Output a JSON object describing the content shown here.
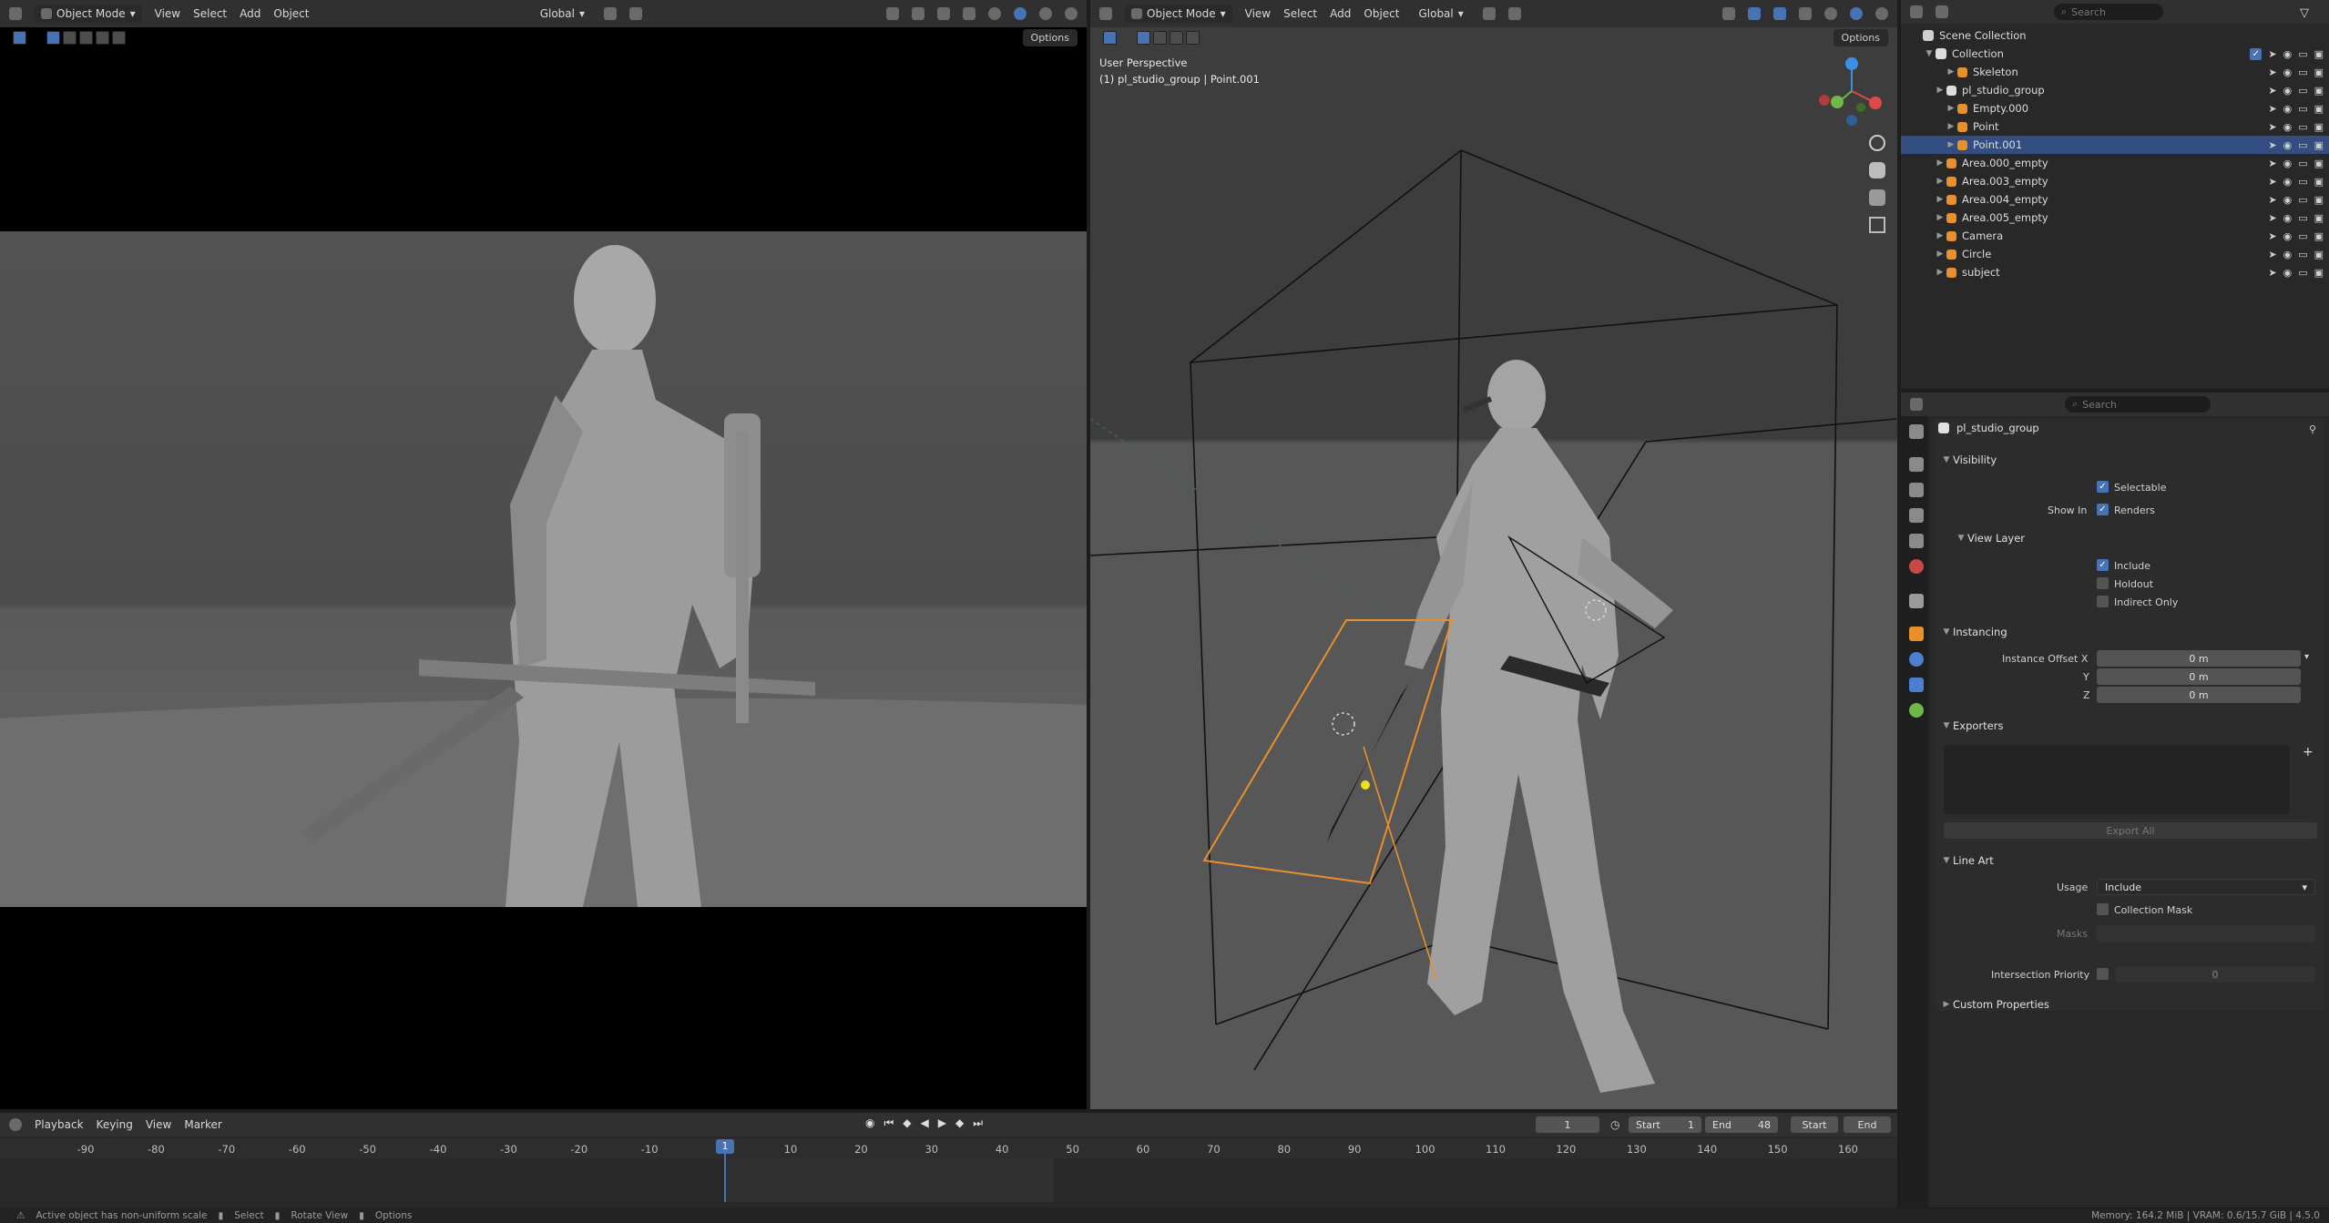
{
  "left_viewport": {
    "mode": "Object Mode",
    "menu": [
      "View",
      "Select",
      "Add",
      "Object"
    ],
    "orientation": "Global",
    "options": "Options"
  },
  "right_viewport": {
    "mode": "Object Mode",
    "menu": [
      "View",
      "Select",
      "Add",
      "Object"
    ],
    "orientation": "Global",
    "options": "Options",
    "overlay_title": "User Perspective",
    "overlay_sub": "(1) pl_studio_group | Point.001"
  },
  "outliner": {
    "search_placeholder": "Search",
    "scene_collection": "Scene Collection",
    "collection": "Collection",
    "rows": [
      {
        "label": "Skeleton",
        "indent": 2
      },
      {
        "label": "pl_studio_group",
        "indent": 1
      },
      {
        "label": "Empty.000",
        "indent": 2
      },
      {
        "label": "Point",
        "indent": 2
      },
      {
        "label": "Point.001",
        "indent": 2,
        "selected": true
      },
      {
        "label": "Area.000_empty",
        "indent": 1
      },
      {
        "label": "Area.003_empty",
        "indent": 1
      },
      {
        "label": "Area.004_empty",
        "indent": 1
      },
      {
        "label": "Area.005_empty",
        "indent": 1
      },
      {
        "label": "Camera",
        "indent": 1
      },
      {
        "label": "Circle",
        "indent": 1
      },
      {
        "label": "subject",
        "indent": 1
      }
    ]
  },
  "properties": {
    "search_placeholder": "Search",
    "object_name": "pl_studio_group",
    "visibility": "Visibility",
    "selectable": "Selectable",
    "show_in": "Show In",
    "renders": "Renders",
    "view_layer": "View Layer",
    "include": "Include",
    "holdout": "Holdout",
    "indirect_only": "Indirect Only",
    "instancing": "Instancing",
    "instance_offset_x": "Instance Offset X",
    "y": "Y",
    "z": "Z",
    "offset_x_val": "0 m",
    "offset_y_val": "0 m",
    "offset_z_val": "0 m",
    "exporters": "Exporters",
    "export_all": "Export All",
    "line_art": "Line Art",
    "usage": "Usage",
    "usage_val": "Include",
    "collection_mask": "Collection Mask",
    "masks": "Masks",
    "intersection_priority": "Intersection Priority",
    "intersection_val": "0",
    "custom_properties": "Custom Properties"
  },
  "timeline": {
    "menu": [
      "Playback",
      "Keying",
      "View",
      "Marker"
    ],
    "current_frame": "1",
    "start_label": "Start",
    "start_val": "1",
    "end_label": "End",
    "end_val": "48",
    "start_btn": "Start",
    "end_btn": "End",
    "ticks": [
      "-90",
      "-80",
      "-70",
      "-60",
      "-50",
      "-40",
      "-30",
      "-20",
      "-10",
      "1",
      "10",
      "20",
      "30",
      "40",
      "50",
      "60",
      "70",
      "80",
      "90",
      "100",
      "110",
      "120",
      "130",
      "140",
      "150",
      "160"
    ]
  },
  "status": {
    "message": "Active object has non-uniform scale",
    "select": "Select",
    "rotate": "Rotate View",
    "options": "Options",
    "memory": "Memory: 164.2 MiB | VRAM: 0.6/15.7 GiB | 4.5.0"
  },
  "colors": {
    "accent": "#4772b3",
    "selection": "#334d80",
    "light_outline": "#e8902c",
    "playhead": "#4772b3"
  }
}
